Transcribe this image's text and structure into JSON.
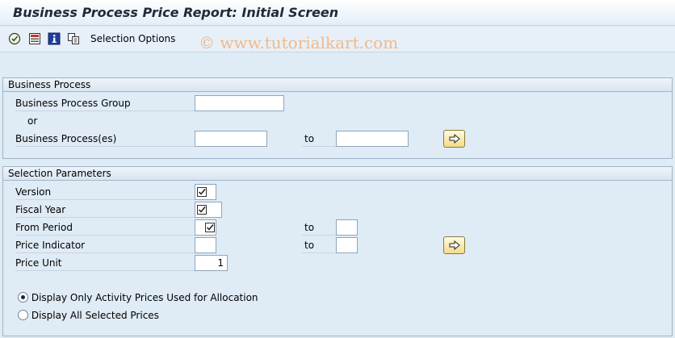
{
  "window": {
    "title": "Business Process Price Report: Initial Screen"
  },
  "toolbar": {
    "icons": [
      "execute-icon",
      "save-variant-icon",
      "information-icon",
      "copy-icon"
    ],
    "selection_options_label": "Selection Options"
  },
  "watermark": "© www.tutorialkart.com",
  "business_process": {
    "header": "Business Process",
    "group_label": "Business Process Group",
    "group_value": "",
    "or_label": "or",
    "processes_label": "Business Process(es)",
    "processes_from": "",
    "to_label": "to",
    "processes_to": ""
  },
  "selection": {
    "header": "Selection Parameters",
    "version_label": "Version",
    "fiscal_year_label": "Fiscal Year",
    "from_period_label": "From Period",
    "from_period_to_label": "to",
    "from_period_to_value": "",
    "price_indicator_label": "Price Indicator",
    "price_indicator_value": "",
    "price_indicator_to_label": "to",
    "price_indicator_to_value": "",
    "price_unit_label": "Price Unit",
    "price_unit_value": "1"
  },
  "options": {
    "radio1_label": "Display Only Activity Prices Used for Allocation",
    "radio1_selected": true,
    "radio2_label": "Display All Selected Prices",
    "radio2_selected": false
  },
  "colors": {
    "background": "#dfebf5",
    "watermark": "#f1b98a",
    "button_fill": "#f1dc8a"
  }
}
